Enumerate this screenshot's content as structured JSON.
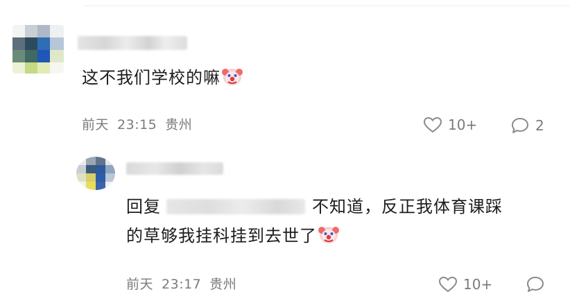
{
  "comment": {
    "text": "这不我们学校的嘛",
    "emoji": "clown-face-icon",
    "date": "前天",
    "time": "23:15",
    "location": "贵州",
    "likes": "10+",
    "replies": "2"
  },
  "reply": {
    "prefix": "回复",
    "text_part1": "不知道，反正我体育课踩",
    "text_part2": "的草够我挂科挂到去世了",
    "emoji": "clown-face-icon",
    "date": "前天",
    "time": "23:17",
    "location": "贵州",
    "likes": "10+"
  },
  "colors": {
    "text": "#1c1c1c",
    "meta": "#7a7a7a",
    "icon": "#8a8a8a"
  }
}
